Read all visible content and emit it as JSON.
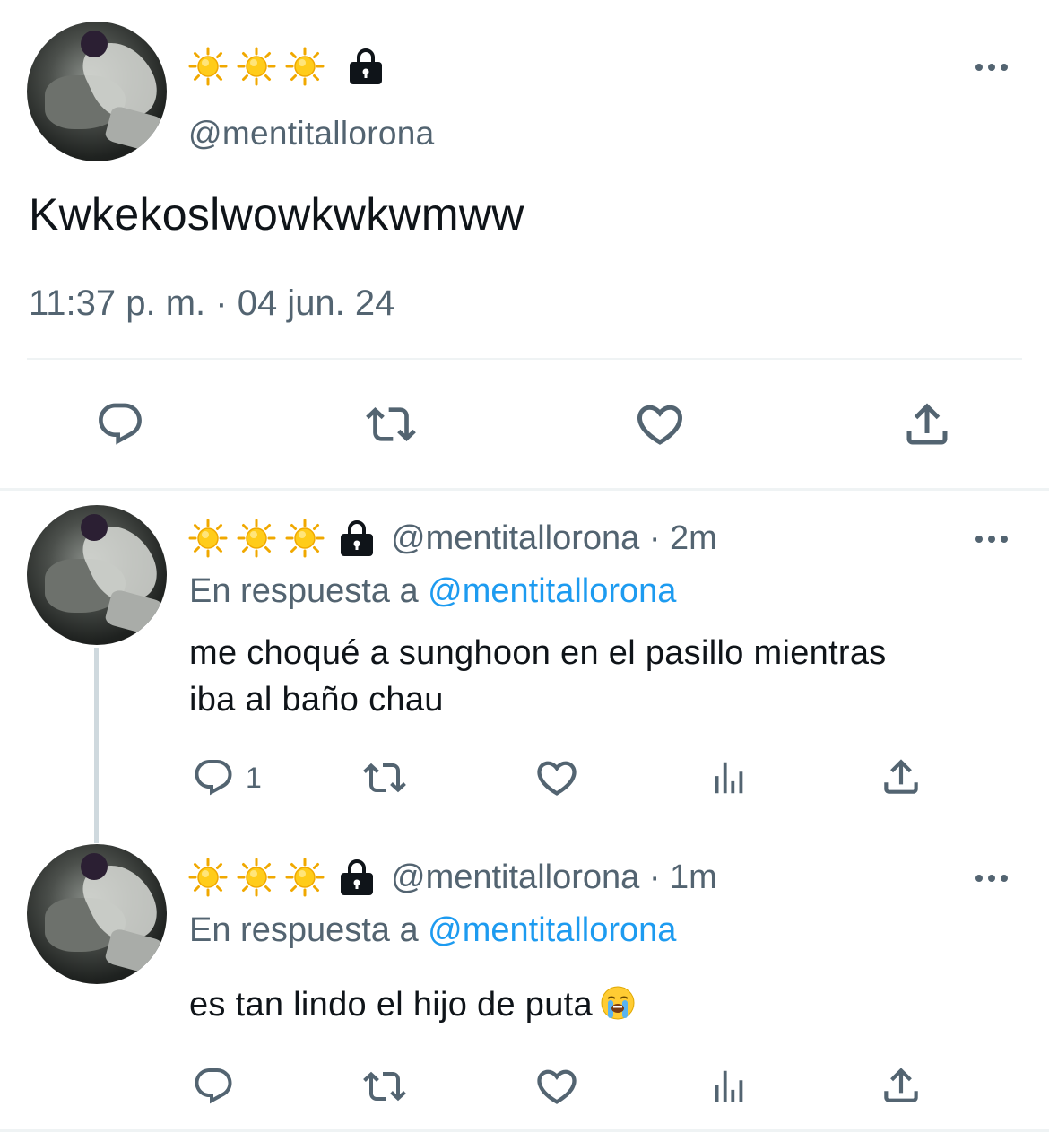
{
  "main_tweet": {
    "display_name_icons": [
      "sun-icon",
      "sun-icon",
      "sun-icon",
      "lock-icon"
    ],
    "handle": "@mentitallorona",
    "text": "Kwkekoslwowkwkwmww",
    "timestamp": "11:37 p. m. · 04 jun. 24",
    "actions": [
      "reply-icon",
      "retweet-icon",
      "like-icon",
      "share-icon"
    ]
  },
  "replies": [
    {
      "display_name_icons": [
        "sun-icon",
        "sun-icon",
        "sun-icon",
        "lock-icon"
      ],
      "handle_time": "@mentitallorona · 2m",
      "replying_prefix": "En respuesta a ",
      "replying_to": "@mentitallorona",
      "text_line1": "me choqué a sunghoon en el pasillo mientras",
      "text_line2": "iba al baño chau",
      "reply_count": "1",
      "actions": [
        "reply-icon",
        "retweet-icon",
        "like-icon",
        "views-icon",
        "share-icon"
      ]
    },
    {
      "display_name_icons": [
        "sun-icon",
        "sun-icon",
        "sun-icon",
        "lock-icon"
      ],
      "handle_time": "@mentitallorona · 1m",
      "replying_prefix": "En respuesta a ",
      "replying_to": "@mentitallorona",
      "text": "es tan lindo el hijo de puta",
      "emoji": "loudly-crying-face-icon",
      "actions": [
        "reply-icon",
        "retweet-icon",
        "like-icon",
        "views-icon",
        "share-icon"
      ]
    }
  ],
  "colors": {
    "text_primary": "#0f1419",
    "text_secondary": "#536471",
    "link": "#1d9bf0",
    "divider": "#eff3f4",
    "thread_line": "#cfd9de",
    "sun": "#f5b400"
  }
}
